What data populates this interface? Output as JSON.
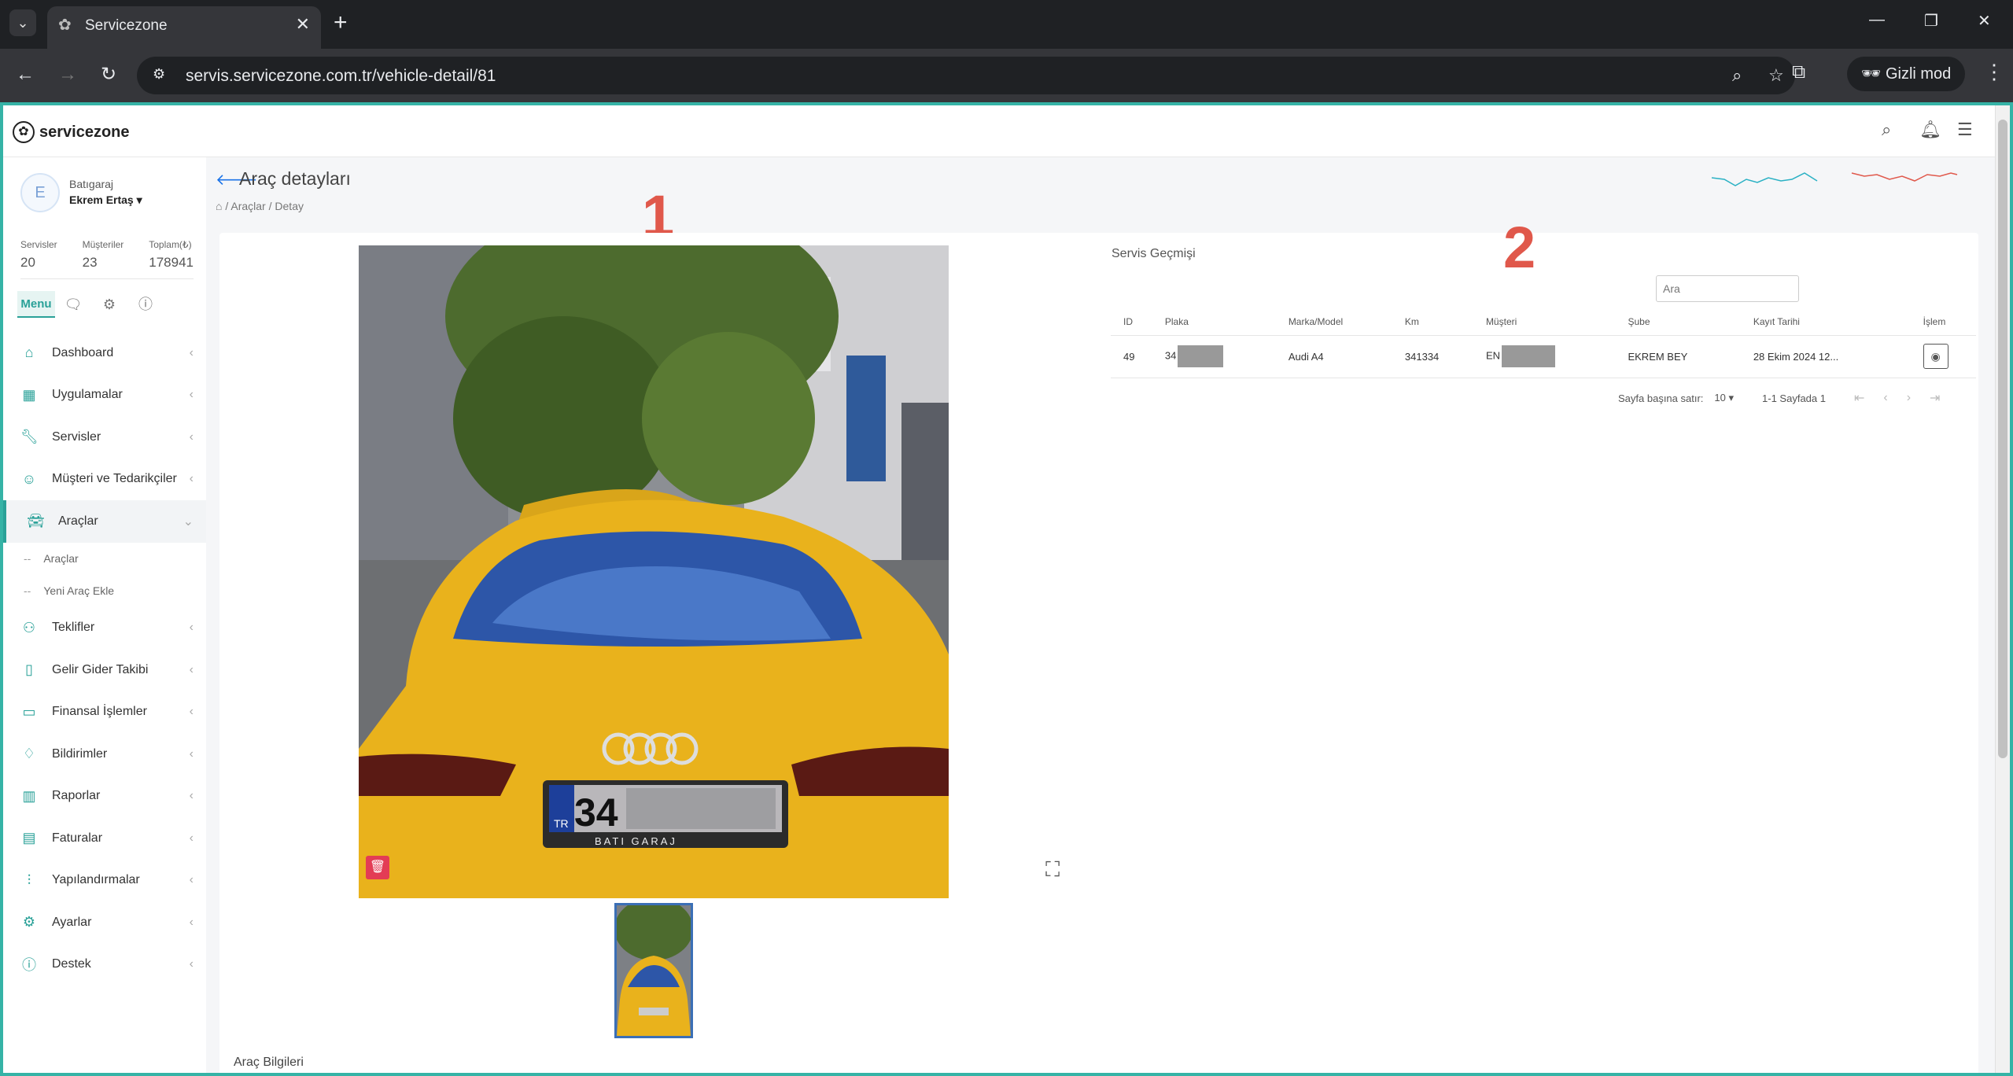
{
  "browser": {
    "tab_title": "Servicezone",
    "url": "servis.servicezone.com.tr/vehicle-detail/81",
    "incognito_label": "Gizli mod"
  },
  "app": {
    "logo_text": "servicezone",
    "user": {
      "initial": "E",
      "company": "Batıgaraj",
      "name": "Ekrem Ertaş"
    },
    "stats": [
      {
        "label": "Servisler",
        "value": "20"
      },
      {
        "label": "Müşteriler",
        "value": "23"
      },
      {
        "label": "Toplam(₺)",
        "value": "178941"
      }
    ],
    "side_tabs": {
      "menu": "Menu"
    },
    "menu": [
      {
        "label": "Dashboard",
        "icon": "home-icon"
      },
      {
        "label": "Uygulamalar",
        "icon": "grid-icon"
      },
      {
        "label": "Servisler",
        "icon": "wrench-icon"
      },
      {
        "label": "Müşteri ve Tedarikçiler",
        "icon": "users-icon"
      },
      {
        "label": "Araçlar",
        "icon": "car-icon"
      },
      {
        "label": "Teklifler",
        "icon": "offer-icon"
      },
      {
        "label": "Gelir Gider Takibi",
        "icon": "book-icon"
      },
      {
        "label": "Finansal İşlemler",
        "icon": "wallet-icon"
      },
      {
        "label": "Bildirimler",
        "icon": "bell-icon"
      },
      {
        "label": "Raporlar",
        "icon": "chart-icon"
      },
      {
        "label": "Faturalar",
        "icon": "invoice-icon"
      },
      {
        "label": "Yapılandırmalar",
        "icon": "sliders-icon"
      },
      {
        "label": "Ayarlar",
        "icon": "gear-icon"
      },
      {
        "label": "Destek",
        "icon": "info-icon"
      }
    ],
    "submenu": [
      {
        "label": "Araçlar"
      },
      {
        "label": "Yeni Araç Ekle"
      }
    ]
  },
  "page": {
    "title": "Araç detayları",
    "breadcrumb": [
      "Araçlar",
      "Detay"
    ],
    "section_label": "Araç Bilgileri"
  },
  "history": {
    "title": "Servis Geçmişi",
    "search_placeholder": "Ara",
    "columns": [
      "ID",
      "Plaka",
      "Marka/Model",
      "Km",
      "Müşteri",
      "Şube",
      "Kayıt Tarihi",
      "İşlem"
    ],
    "rows": [
      {
        "id": "49",
        "plate": "34",
        "model": "Audi A4",
        "km": "341334",
        "customer": "EN",
        "branch": "EKREM BEY",
        "date": "28 Ekim 2024 12..."
      }
    ],
    "pager": {
      "rows_per_page_label": "Sayfa başına satır:",
      "rows_per_page": "10",
      "range": "1-1 Sayfada 1"
    }
  },
  "plate": {
    "country": "TR",
    "prefix": "34",
    "dealer": "BATI GARAJ"
  },
  "annotations": [
    "1",
    "2"
  ],
  "colors": {
    "accent": "#2aa198",
    "delete": "#e33c55",
    "annotation": "#e0584b",
    "car": "#e9b21c"
  }
}
